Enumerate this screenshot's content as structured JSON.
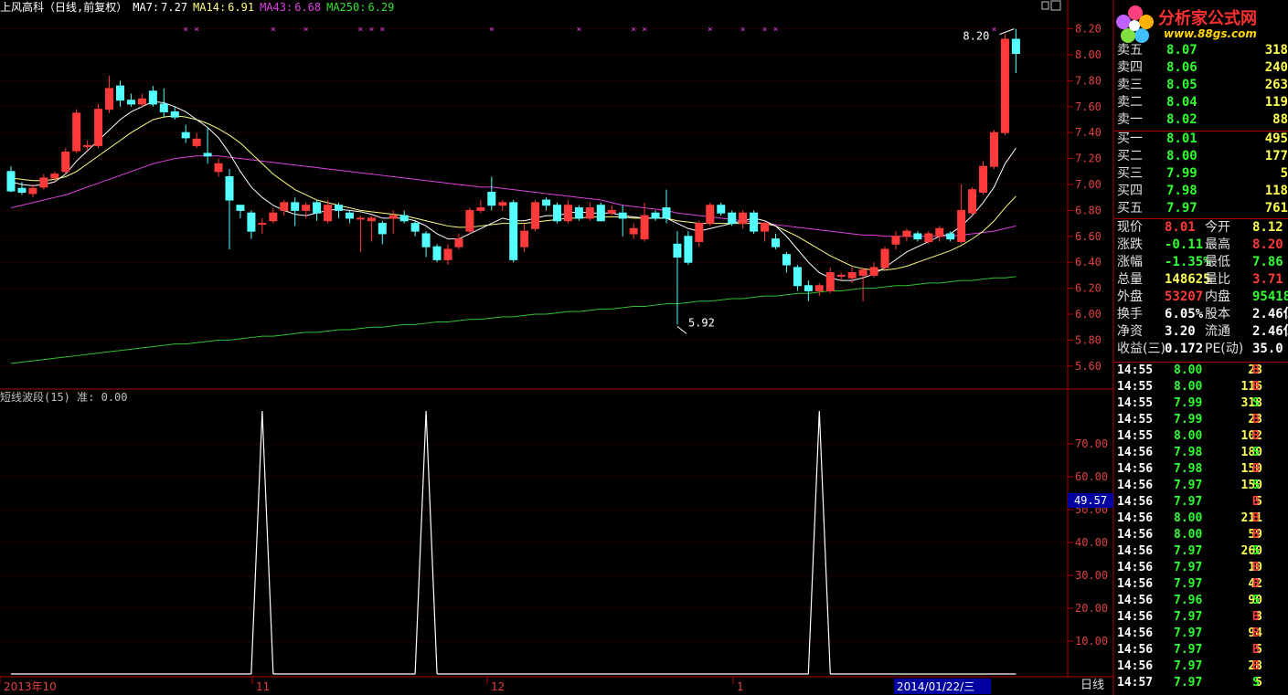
{
  "header": {
    "stock_info": "上风高科（日线,前复权）",
    "ma7_label": "MA7:",
    "ma7_value": "7.27",
    "ma14_label": "MA14:",
    "ma14_value": "6.91",
    "ma43_label": "MA43:",
    "ma43_value": "6.68",
    "ma250_label": "MA250:",
    "ma250_value": "6.29"
  },
  "indicator": {
    "title": "短线波段(15)",
    "value_label": "准:",
    "value": "0.00",
    "cursor_value": "49.57"
  },
  "colors": {
    "up": "#ff3a3a",
    "down": "#54ffff",
    "ma7": "#ffffff",
    "ma14": "#ffff80",
    "ma43": "#e040e0",
    "ma250": "#30c030",
    "axis": "#b00000"
  },
  "price_axis": {
    "ticks": [
      "8.20",
      "8.00",
      "7.80",
      "7.60",
      "7.40",
      "7.20",
      "7.00",
      "6.80",
      "6.60",
      "6.40",
      "6.20",
      "6.00",
      "5.80",
      "5.60"
    ]
  },
  "indicator_axis": {
    "ticks": [
      "70.00",
      "60.00",
      "50.00",
      "40.00",
      "30.00",
      "20.00",
      "10.00"
    ]
  },
  "time_axis": {
    "labels": [
      "2013年10",
      "11",
      "12",
      "1"
    ],
    "cursor_date": "2014/01/22/三"
  },
  "annotations": {
    "high": "8.20",
    "low": "5.92"
  },
  "chart_data": {
    "type": "candlestick",
    "ylim": [
      5.5,
      8.3
    ],
    "candles": [
      [
        7.1,
        6.95,
        7.14,
        6.94
      ],
      [
        6.97,
        6.94,
        7.02,
        6.92
      ],
      [
        6.93,
        6.97,
        7.0,
        6.9
      ],
      [
        6.98,
        7.05,
        7.08,
        6.96
      ],
      [
        7.05,
        7.08,
        7.1,
        7.02
      ],
      [
        7.1,
        7.25,
        7.28,
        7.08
      ],
      [
        7.26,
        7.55,
        7.58,
        7.24
      ],
      [
        7.3,
        7.3,
        7.34,
        7.26
      ],
      [
        7.3,
        7.58,
        7.62,
        7.28
      ],
      [
        7.58,
        7.74,
        7.84,
        7.55
      ],
      [
        7.76,
        7.65,
        7.8,
        7.6
      ],
      [
        7.65,
        7.62,
        7.7,
        7.6
      ],
      [
        7.62,
        7.66,
        7.7,
        7.6
      ],
      [
        7.72,
        7.62,
        7.76,
        7.6
      ],
      [
        7.62,
        7.56,
        7.74,
        7.52
      ],
      [
        7.56,
        7.52,
        7.6,
        7.5
      ],
      [
        7.4,
        7.36,
        7.46,
        7.32
      ],
      [
        7.3,
        7.35,
        7.4,
        7.28
      ],
      [
        7.24,
        7.22,
        7.44,
        7.16
      ],
      [
        7.1,
        7.16,
        7.2,
        7.06
      ],
      [
        7.06,
        6.88,
        7.12,
        6.5
      ],
      [
        6.84,
        6.8,
        6.84,
        6.74
      ],
      [
        6.78,
        6.64,
        6.8,
        6.58
      ],
      [
        6.7,
        6.7,
        6.74,
        6.62
      ],
      [
        6.72,
        6.78,
        6.82,
        6.7
      ],
      [
        6.8,
        6.86,
        6.88,
        6.76
      ],
      [
        6.86,
        6.8,
        6.9,
        6.68
      ],
      [
        6.8,
        6.84,
        6.86,
        6.74
      ],
      [
        6.86,
        6.78,
        6.88,
        6.72
      ],
      [
        6.72,
        6.84,
        6.88,
        6.7
      ],
      [
        6.84,
        6.8,
        6.86,
        6.74
      ],
      [
        6.78,
        6.74,
        6.8,
        6.7
      ],
      [
        6.74,
        6.74,
        6.76,
        6.48
      ],
      [
        6.72,
        6.74,
        6.76,
        6.56
      ],
      [
        6.7,
        6.62,
        6.72,
        6.54
      ],
      [
        6.74,
        6.76,
        6.8,
        6.62
      ],
      [
        6.76,
        6.72,
        6.8,
        6.7
      ],
      [
        6.7,
        6.64,
        6.72,
        6.6
      ],
      [
        6.62,
        6.52,
        6.64,
        6.44
      ],
      [
        6.52,
        6.42,
        6.54,
        6.4
      ],
      [
        6.42,
        6.5,
        6.54,
        6.38
      ],
      [
        6.52,
        6.58,
        6.62,
        6.5
      ],
      [
        6.64,
        6.8,
        6.82,
        6.62
      ],
      [
        6.8,
        6.82,
        6.88,
        6.78
      ],
      [
        6.94,
        6.84,
        7.06,
        6.8
      ],
      [
        6.84,
        6.86,
        6.88,
        6.8
      ],
      [
        6.86,
        6.42,
        6.88,
        6.4
      ],
      [
        6.52,
        6.64,
        6.7,
        6.48
      ],
      [
        6.66,
        6.86,
        6.88,
        6.64
      ],
      [
        6.88,
        6.84,
        6.9,
        6.8
      ],
      [
        6.84,
        6.72,
        6.86,
        6.7
      ],
      [
        6.72,
        6.84,
        6.88,
        6.7
      ],
      [
        6.82,
        6.74,
        6.84,
        6.72
      ],
      [
        6.74,
        6.82,
        6.86,
        6.72
      ],
      [
        6.84,
        6.72,
        6.86,
        6.72
      ],
      [
        6.78,
        6.8,
        6.84,
        6.76
      ],
      [
        6.78,
        6.74,
        6.84,
        6.6
      ],
      [
        6.62,
        6.66,
        6.7,
        6.58
      ],
      [
        6.58,
        6.76,
        6.86,
        6.56
      ],
      [
        6.78,
        6.74,
        6.8,
        6.72
      ],
      [
        6.82,
        6.74,
        6.96,
        6.7
      ],
      [
        6.54,
        6.44,
        6.64,
        5.92
      ],
      [
        6.6,
        6.4,
        6.64,
        6.38
      ],
      [
        6.56,
        6.7,
        6.72,
        6.52
      ],
      [
        6.7,
        6.84,
        6.86,
        6.68
      ],
      [
        6.84,
        6.78,
        6.86,
        6.76
      ],
      [
        6.78,
        6.7,
        6.8,
        6.68
      ],
      [
        6.7,
        6.78,
        6.8,
        6.66
      ],
      [
        6.78,
        6.64,
        6.8,
        6.62
      ],
      [
        6.64,
        6.7,
        6.72,
        6.56
      ],
      [
        6.58,
        6.52,
        6.62,
        6.5
      ],
      [
        6.46,
        6.38,
        6.48,
        6.32
      ],
      [
        6.36,
        6.22,
        6.38,
        6.18
      ],
      [
        6.22,
        6.18,
        6.26,
        6.1
      ],
      [
        6.18,
        6.22,
        6.24,
        6.14
      ],
      [
        6.18,
        6.32,
        6.36,
        6.16
      ],
      [
        6.3,
        6.3,
        6.32,
        6.26
      ],
      [
        6.28,
        6.32,
        6.36,
        6.24
      ],
      [
        6.3,
        6.34,
        6.36,
        6.1
      ],
      [
        6.3,
        6.36,
        6.4,
        6.28
      ],
      [
        6.36,
        6.5,
        6.52,
        6.34
      ],
      [
        6.54,
        6.6,
        6.64,
        6.5
      ],
      [
        6.6,
        6.64,
        6.66,
        6.56
      ],
      [
        6.62,
        6.58,
        6.64,
        6.56
      ],
      [
        6.56,
        6.62,
        6.64,
        6.54
      ],
      [
        6.6,
        6.66,
        6.68,
        6.56
      ],
      [
        6.62,
        6.58,
        6.64,
        6.56
      ],
      [
        6.56,
        6.8,
        7.0,
        6.54
      ],
      [
        6.78,
        6.96,
        6.98,
        6.76
      ],
      [
        6.94,
        7.14,
        7.18,
        6.92
      ],
      [
        7.14,
        7.4,
        7.42,
        7.12
      ],
      [
        7.4,
        8.12,
        8.16,
        7.38
      ],
      [
        8.12,
        8.01,
        8.2,
        7.86
      ]
    ],
    "ma7": [
      7.02,
      7.0,
      6.99,
      7.0,
      7.02,
      7.08,
      7.18,
      7.26,
      7.34,
      7.42,
      7.5,
      7.56,
      7.6,
      7.64,
      7.63,
      7.6,
      7.56,
      7.5,
      7.44,
      7.36,
      7.24,
      7.1,
      6.98,
      6.9,
      6.84,
      6.8,
      6.77,
      6.76,
      6.78,
      6.8,
      6.81,
      6.8,
      6.79,
      6.77,
      6.74,
      6.74,
      6.74,
      6.72,
      6.68,
      6.62,
      6.58,
      6.58,
      6.62,
      6.66,
      6.7,
      6.74,
      6.72,
      6.72,
      6.74,
      6.76,
      6.76,
      6.78,
      6.79,
      6.78,
      6.78,
      6.78,
      6.76,
      6.75,
      6.74,
      6.74,
      6.74,
      6.7,
      6.66,
      6.64,
      6.66,
      6.68,
      6.7,
      6.72,
      6.74,
      6.72,
      6.68,
      6.6,
      6.5,
      6.4,
      6.32,
      6.28,
      6.26,
      6.26,
      6.28,
      6.31,
      6.36,
      6.42,
      6.48,
      6.52,
      6.56,
      6.6,
      6.62,
      6.68,
      6.76,
      6.86,
      6.98,
      7.16,
      7.28
    ],
    "ma14": [
      7.05,
      7.04,
      7.03,
      7.03,
      7.04,
      7.06,
      7.1,
      7.16,
      7.22,
      7.28,
      7.34,
      7.4,
      7.45,
      7.5,
      7.52,
      7.53,
      7.52,
      7.5,
      7.47,
      7.43,
      7.38,
      7.32,
      7.24,
      7.16,
      7.08,
      7.02,
      6.96,
      6.92,
      6.88,
      6.86,
      6.84,
      6.82,
      6.8,
      6.79,
      6.78,
      6.77,
      6.76,
      6.74,
      6.72,
      6.7,
      6.68,
      6.67,
      6.67,
      6.68,
      6.69,
      6.7,
      6.7,
      6.7,
      6.71,
      6.72,
      6.73,
      6.74,
      6.74,
      6.75,
      6.75,
      6.75,
      6.75,
      6.74,
      6.74,
      6.74,
      6.74,
      6.72,
      6.71,
      6.7,
      6.7,
      6.7,
      6.7,
      6.7,
      6.7,
      6.7,
      6.68,
      6.64,
      6.6,
      6.55,
      6.5,
      6.45,
      6.41,
      6.37,
      6.35,
      6.34,
      6.34,
      6.35,
      6.37,
      6.4,
      6.43,
      6.46,
      6.49,
      6.53,
      6.58,
      6.64,
      6.72,
      6.82,
      6.91
    ],
    "ma43": [
      6.82,
      6.84,
      6.86,
      6.88,
      6.9,
      6.92,
      6.95,
      6.98,
      7.01,
      7.04,
      7.07,
      7.1,
      7.13,
      7.16,
      7.18,
      7.2,
      7.21,
      7.22,
      7.22,
      7.22,
      7.21,
      7.2,
      7.19,
      7.18,
      7.17,
      7.16,
      7.15,
      7.14,
      7.13,
      7.12,
      7.11,
      7.1,
      7.09,
      7.08,
      7.07,
      7.06,
      7.05,
      7.04,
      7.03,
      7.02,
      7.01,
      7.0,
      6.99,
      6.98,
      6.98,
      6.97,
      6.96,
      6.95,
      6.94,
      6.93,
      6.92,
      6.91,
      6.9,
      6.89,
      6.88,
      6.86,
      6.84,
      6.83,
      6.82,
      6.81,
      6.8,
      6.78,
      6.77,
      6.76,
      6.75,
      6.74,
      6.73,
      6.72,
      6.71,
      6.7,
      6.69,
      6.68,
      6.67,
      6.66,
      6.65,
      6.64,
      6.63,
      6.62,
      6.61,
      6.61,
      6.6,
      6.6,
      6.6,
      6.6,
      6.6,
      6.6,
      6.6,
      6.61,
      6.62,
      6.63,
      6.64,
      6.66,
      6.68
    ],
    "ma250": [
      5.62,
      5.63,
      5.64,
      5.65,
      5.66,
      5.67,
      5.68,
      5.69,
      5.7,
      5.71,
      5.72,
      5.73,
      5.74,
      5.75,
      5.76,
      5.77,
      5.77,
      5.78,
      5.79,
      5.8,
      5.8,
      5.81,
      5.82,
      5.83,
      5.83,
      5.84,
      5.85,
      5.86,
      5.86,
      5.87,
      5.88,
      5.88,
      5.89,
      5.9,
      5.9,
      5.91,
      5.92,
      5.92,
      5.93,
      5.94,
      5.94,
      5.95,
      5.96,
      5.96,
      5.97,
      5.98,
      5.98,
      5.99,
      6.0,
      6.0,
      6.01,
      6.02,
      6.02,
      6.03,
      6.04,
      6.04,
      6.05,
      6.06,
      6.06,
      6.07,
      6.08,
      6.08,
      6.09,
      6.1,
      6.1,
      6.11,
      6.12,
      6.12,
      6.13,
      6.14,
      6.14,
      6.15,
      6.16,
      6.16,
      6.17,
      6.18,
      6.18,
      6.19,
      6.2,
      6.2,
      6.21,
      6.22,
      6.22,
      6.23,
      6.24,
      6.24,
      6.25,
      6.26,
      6.26,
      6.27,
      6.28,
      6.28,
      6.29
    ],
    "signal_marks": [
      16,
      17,
      24,
      27,
      32,
      33,
      34,
      44,
      52,
      57,
      58,
      64,
      67,
      69,
      70,
      90
    ],
    "indicator": {
      "ylim": [
        0,
        82
      ],
      "peaks": [
        23,
        38,
        74
      ],
      "peak_value": 80
    }
  },
  "quotes": {
    "sell": [
      {
        "label": "卖五",
        "price": "8.07",
        "vol": "318"
      },
      {
        "label": "卖四",
        "price": "8.06",
        "vol": "240"
      },
      {
        "label": "卖三",
        "price": "8.05",
        "vol": "263"
      },
      {
        "label": "卖二",
        "price": "8.04",
        "vol": "119"
      },
      {
        "label": "卖一",
        "price": "8.02",
        "vol": "88"
      }
    ],
    "buy": [
      {
        "label": "买一",
        "price": "8.01",
        "vol": "495"
      },
      {
        "label": "买二",
        "price": "8.00",
        "vol": "177"
      },
      {
        "label": "买三",
        "price": "7.99",
        "vol": "5"
      },
      {
        "label": "买四",
        "price": "7.98",
        "vol": "118"
      },
      {
        "label": "买五",
        "price": "7.97",
        "vol": "761"
      }
    ],
    "stats": [
      {
        "l1": "现价",
        "v1": "8.01",
        "l2": "今开",
        "v2": "8.12"
      },
      {
        "l1": "涨跌",
        "v1": "-0.11",
        "l2": "最高",
        "v2": "8.20"
      },
      {
        "l1": "涨幅",
        "v1": "-1.35%",
        "l2": "最低",
        "v2": "7.86"
      },
      {
        "l1": "总量",
        "v1": "148625",
        "l2": "量比",
        "v2": "3.71"
      },
      {
        "l1": "外盘",
        "v1": "53207",
        "l2": "内盘",
        "v2": "95418"
      },
      {
        "l1": "换手",
        "v1": "6.05%",
        "l2": "股本",
        "v2": "2.46亿"
      },
      {
        "l1": "净资",
        "v1": "3.20",
        "l2": "流通",
        "v2": "2.46亿"
      },
      {
        "l1": "收益(三)",
        "v1": "0.172",
        "l2": "PE(动)",
        "v2": "35.0"
      }
    ]
  },
  "ticks": [
    {
      "t": "14:55",
      "p": "8.00",
      "v": "23",
      "s": "B"
    },
    {
      "t": "14:55",
      "p": "8.00",
      "v": "116",
      "s": "B"
    },
    {
      "t": "14:55",
      "p": "7.99",
      "v": "318",
      "s": "S"
    },
    {
      "t": "14:55",
      "p": "7.99",
      "v": "23",
      "s": "B"
    },
    {
      "t": "14:55",
      "p": "8.00",
      "v": "102",
      "s": "B"
    },
    {
      "t": "14:56",
      "p": "7.98",
      "v": "180",
      "s": "S"
    },
    {
      "t": "14:56",
      "p": "7.98",
      "v": "150",
      "s": "B"
    },
    {
      "t": "14:56",
      "p": "7.97",
      "v": "150",
      "s": "S"
    },
    {
      "t": "14:56",
      "p": "7.97",
      "v": "5",
      "s": "B"
    },
    {
      "t": "14:56",
      "p": "8.00",
      "v": "211",
      "s": "B"
    },
    {
      "t": "14:56",
      "p": "8.00",
      "v": "59",
      "s": "B"
    },
    {
      "t": "14:56",
      "p": "7.97",
      "v": "260",
      "s": "S"
    },
    {
      "t": "14:56",
      "p": "7.97",
      "v": "10",
      "s": "B"
    },
    {
      "t": "14:56",
      "p": "7.97",
      "v": "42",
      "s": "B"
    },
    {
      "t": "14:56",
      "p": "7.96",
      "v": "90",
      "s": "S"
    },
    {
      "t": "14:56",
      "p": "7.97",
      "v": "3",
      "s": "B"
    },
    {
      "t": "14:56",
      "p": "7.97",
      "v": "94",
      "s": "B"
    },
    {
      "t": "14:56",
      "p": "7.97",
      "v": "5",
      "s": "B"
    },
    {
      "t": "14:56",
      "p": "7.97",
      "v": "28",
      "s": "B"
    },
    {
      "t": "14:57",
      "p": "7.97",
      "v": "5",
      "s": "S"
    }
  ],
  "logo": {
    "brand": "分析家公式网",
    "url": "www.88gs.com"
  },
  "bottom_tab": "日线"
}
